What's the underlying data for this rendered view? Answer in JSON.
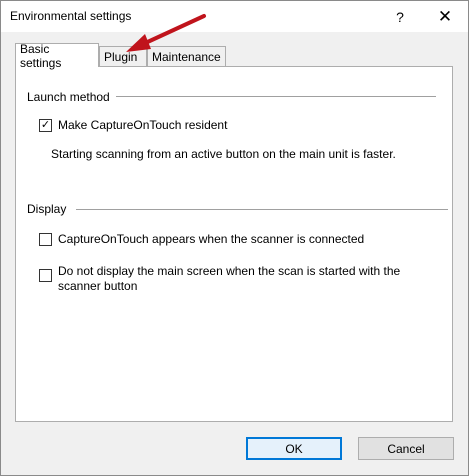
{
  "window": {
    "title": "Environmental settings",
    "help_label": "?",
    "close_label": "✕"
  },
  "tabs": [
    {
      "label": "Basic settings",
      "selected": true
    },
    {
      "label": "Plugin",
      "selected": false
    },
    {
      "label": "Maintenance",
      "selected": false
    }
  ],
  "launch": {
    "group_label": "Launch method",
    "resident_label": "Make CaptureOnTouch resident",
    "resident_checked": true,
    "note": "Starting scanning from an active button on the main unit is faster."
  },
  "display": {
    "group_label": "Display",
    "appear_label": "CaptureOnTouch appears when the scanner is connected",
    "appear_checked": false,
    "no_main_label": "Do not display the main screen when the scan is started with the scanner button",
    "no_main_checked": false
  },
  "buttons": {
    "ok": "OK",
    "cancel": "Cancel"
  },
  "colors": {
    "annotation_arrow": "#c0141c",
    "focus_border": "#0078d7"
  }
}
